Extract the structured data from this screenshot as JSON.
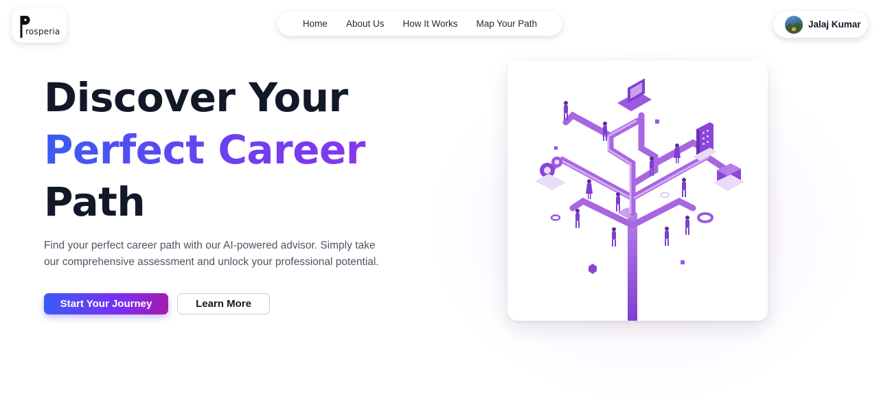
{
  "brand": {
    "logo_letter": "P",
    "logo_text": "rosperia"
  },
  "nav": {
    "items": [
      {
        "label": "Home"
      },
      {
        "label": "About Us"
      },
      {
        "label": "How It Works"
      },
      {
        "label": "Map Your Path"
      }
    ]
  },
  "user": {
    "name": "Jalaj Kumar"
  },
  "hero": {
    "title_line1": "Discover Your",
    "title_line2": "Perfect Career",
    "title_line3": "Path",
    "description": "Find your perfect career path with our AI-powered advisor. Simply take our comprehensive assessment and unlock your professional potential.",
    "primary_cta": "Start Your Journey",
    "secondary_cta": "Learn More"
  },
  "colors": {
    "gradient_start": "#3b5bf5",
    "gradient_end": "#9333ea",
    "illustration_purple": "#8b46d6"
  }
}
